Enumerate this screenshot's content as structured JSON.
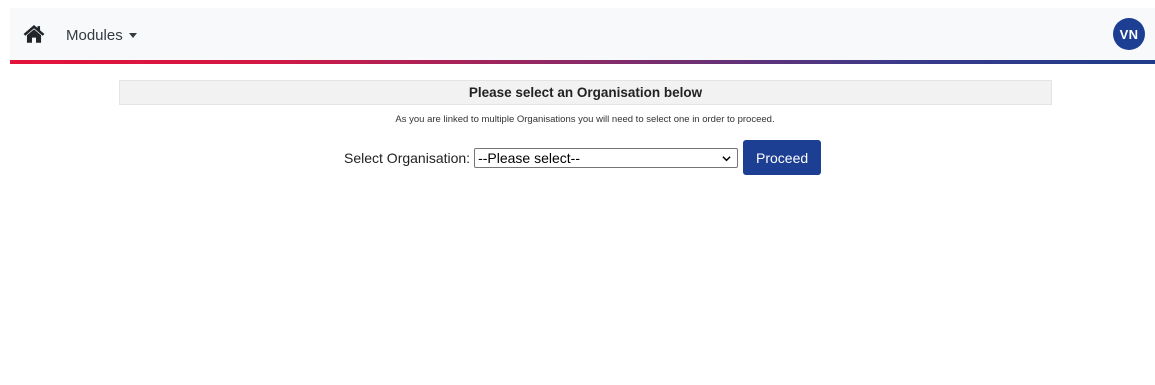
{
  "navbar": {
    "home_icon": "home-icon",
    "modules_label": "Modules",
    "user_initials": "VN"
  },
  "panel": {
    "title": "Please select an Organisation below",
    "info": "As you are linked to multiple Organisations you will need to select one in order to proceed."
  },
  "form": {
    "select_label": "Select Organisation:",
    "select_value": "--Please select--",
    "proceed_label": "Proceed"
  },
  "colors": {
    "brand_blue": "#1c3f94",
    "brand_red": "#e3133a",
    "navbar_bg": "#f8f9fa"
  }
}
